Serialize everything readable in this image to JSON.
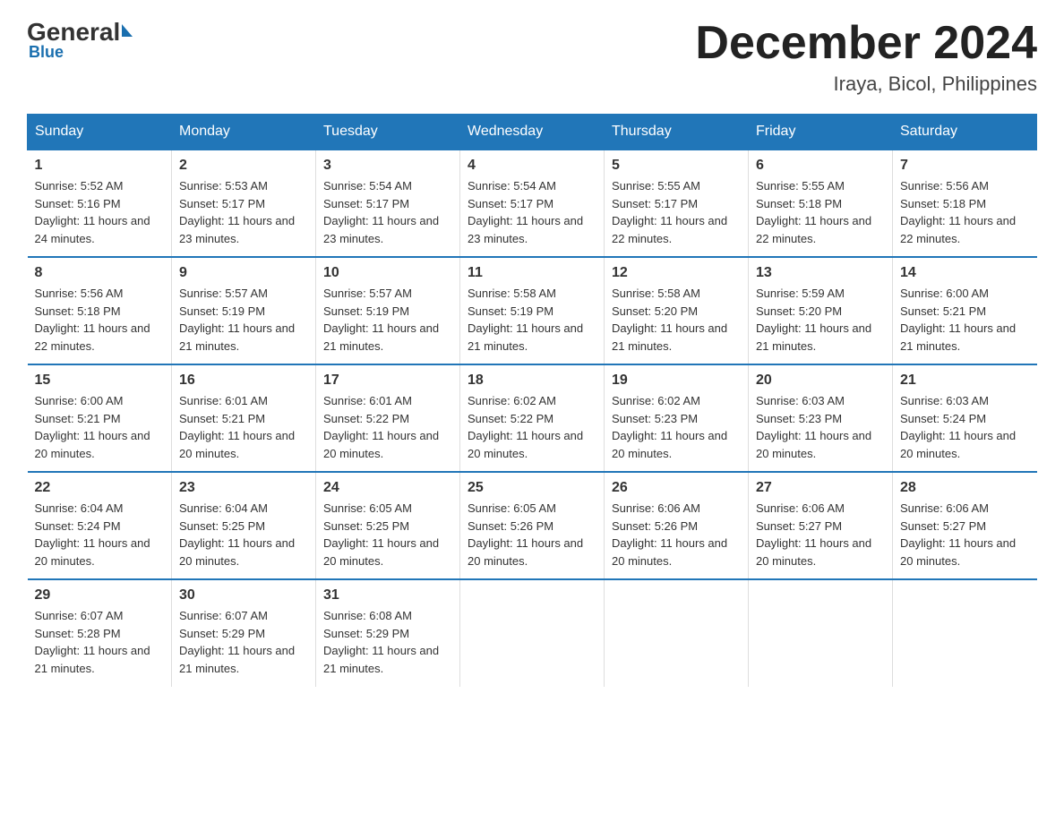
{
  "logo": {
    "general": "General",
    "blue": "Blue"
  },
  "title": "December 2024",
  "location": "Iraya, Bicol, Philippines",
  "days_of_week": [
    "Sunday",
    "Monday",
    "Tuesday",
    "Wednesday",
    "Thursday",
    "Friday",
    "Saturday"
  ],
  "weeks": [
    [
      {
        "num": "1",
        "sunrise": "5:52 AM",
        "sunset": "5:16 PM",
        "daylight": "11 hours and 24 minutes."
      },
      {
        "num": "2",
        "sunrise": "5:53 AM",
        "sunset": "5:17 PM",
        "daylight": "11 hours and 23 minutes."
      },
      {
        "num": "3",
        "sunrise": "5:54 AM",
        "sunset": "5:17 PM",
        "daylight": "11 hours and 23 minutes."
      },
      {
        "num": "4",
        "sunrise": "5:54 AM",
        "sunset": "5:17 PM",
        "daylight": "11 hours and 23 minutes."
      },
      {
        "num": "5",
        "sunrise": "5:55 AM",
        "sunset": "5:17 PM",
        "daylight": "11 hours and 22 minutes."
      },
      {
        "num": "6",
        "sunrise": "5:55 AM",
        "sunset": "5:18 PM",
        "daylight": "11 hours and 22 minutes."
      },
      {
        "num": "7",
        "sunrise": "5:56 AM",
        "sunset": "5:18 PM",
        "daylight": "11 hours and 22 minutes."
      }
    ],
    [
      {
        "num": "8",
        "sunrise": "5:56 AM",
        "sunset": "5:18 PM",
        "daylight": "11 hours and 22 minutes."
      },
      {
        "num": "9",
        "sunrise": "5:57 AM",
        "sunset": "5:19 PM",
        "daylight": "11 hours and 21 minutes."
      },
      {
        "num": "10",
        "sunrise": "5:57 AM",
        "sunset": "5:19 PM",
        "daylight": "11 hours and 21 minutes."
      },
      {
        "num": "11",
        "sunrise": "5:58 AM",
        "sunset": "5:19 PM",
        "daylight": "11 hours and 21 minutes."
      },
      {
        "num": "12",
        "sunrise": "5:58 AM",
        "sunset": "5:20 PM",
        "daylight": "11 hours and 21 minutes."
      },
      {
        "num": "13",
        "sunrise": "5:59 AM",
        "sunset": "5:20 PM",
        "daylight": "11 hours and 21 minutes."
      },
      {
        "num": "14",
        "sunrise": "6:00 AM",
        "sunset": "5:21 PM",
        "daylight": "11 hours and 21 minutes."
      }
    ],
    [
      {
        "num": "15",
        "sunrise": "6:00 AM",
        "sunset": "5:21 PM",
        "daylight": "11 hours and 20 minutes."
      },
      {
        "num": "16",
        "sunrise": "6:01 AM",
        "sunset": "5:21 PM",
        "daylight": "11 hours and 20 minutes."
      },
      {
        "num": "17",
        "sunrise": "6:01 AM",
        "sunset": "5:22 PM",
        "daylight": "11 hours and 20 minutes."
      },
      {
        "num": "18",
        "sunrise": "6:02 AM",
        "sunset": "5:22 PM",
        "daylight": "11 hours and 20 minutes."
      },
      {
        "num": "19",
        "sunrise": "6:02 AM",
        "sunset": "5:23 PM",
        "daylight": "11 hours and 20 minutes."
      },
      {
        "num": "20",
        "sunrise": "6:03 AM",
        "sunset": "5:23 PM",
        "daylight": "11 hours and 20 minutes."
      },
      {
        "num": "21",
        "sunrise": "6:03 AM",
        "sunset": "5:24 PM",
        "daylight": "11 hours and 20 minutes."
      }
    ],
    [
      {
        "num": "22",
        "sunrise": "6:04 AM",
        "sunset": "5:24 PM",
        "daylight": "11 hours and 20 minutes."
      },
      {
        "num": "23",
        "sunrise": "6:04 AM",
        "sunset": "5:25 PM",
        "daylight": "11 hours and 20 minutes."
      },
      {
        "num": "24",
        "sunrise": "6:05 AM",
        "sunset": "5:25 PM",
        "daylight": "11 hours and 20 minutes."
      },
      {
        "num": "25",
        "sunrise": "6:05 AM",
        "sunset": "5:26 PM",
        "daylight": "11 hours and 20 minutes."
      },
      {
        "num": "26",
        "sunrise": "6:06 AM",
        "sunset": "5:26 PM",
        "daylight": "11 hours and 20 minutes."
      },
      {
        "num": "27",
        "sunrise": "6:06 AM",
        "sunset": "5:27 PM",
        "daylight": "11 hours and 20 minutes."
      },
      {
        "num": "28",
        "sunrise": "6:06 AM",
        "sunset": "5:27 PM",
        "daylight": "11 hours and 20 minutes."
      }
    ],
    [
      {
        "num": "29",
        "sunrise": "6:07 AM",
        "sunset": "5:28 PM",
        "daylight": "11 hours and 21 minutes."
      },
      {
        "num": "30",
        "sunrise": "6:07 AM",
        "sunset": "5:29 PM",
        "daylight": "11 hours and 21 minutes."
      },
      {
        "num": "31",
        "sunrise": "6:08 AM",
        "sunset": "5:29 PM",
        "daylight": "11 hours and 21 minutes."
      },
      {
        "num": "",
        "sunrise": "",
        "sunset": "",
        "daylight": ""
      },
      {
        "num": "",
        "sunrise": "",
        "sunset": "",
        "daylight": ""
      },
      {
        "num": "",
        "sunrise": "",
        "sunset": "",
        "daylight": ""
      },
      {
        "num": "",
        "sunrise": "",
        "sunset": "",
        "daylight": ""
      }
    ]
  ]
}
